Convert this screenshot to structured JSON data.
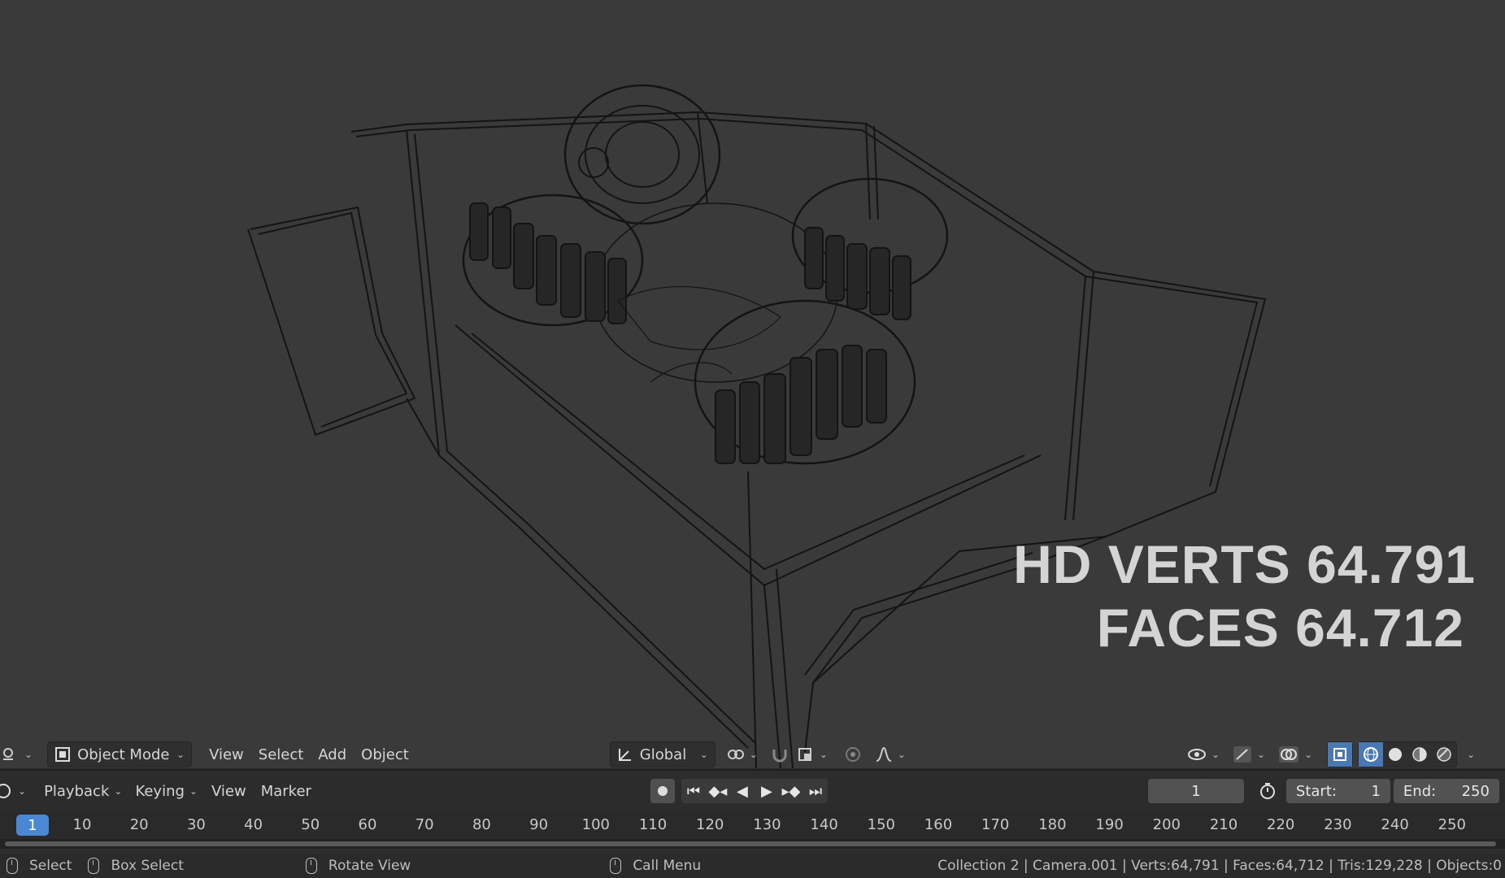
{
  "overlay": {
    "line1": "HD VERTS 64.791",
    "line2": "FACES 64.712"
  },
  "header3d": {
    "mode": "Object Mode",
    "menus": [
      "View",
      "Select",
      "Add",
      "Object"
    ],
    "orientation": "Global"
  },
  "timeline": {
    "menus": [
      "Playback",
      "Keying",
      "View",
      "Marker"
    ],
    "current_frame": "1",
    "start_label": "Start:",
    "start_value": "1",
    "end_label": "End:",
    "end_value": "250",
    "ruler_current": "1",
    "ruler_ticks": [
      "10",
      "20",
      "30",
      "40",
      "50",
      "60",
      "70",
      "80",
      "90",
      "100",
      "110",
      "120",
      "130",
      "140",
      "150",
      "160",
      "170",
      "180",
      "190",
      "200",
      "210",
      "220",
      "230",
      "240",
      "250"
    ]
  },
  "status": {
    "select": "Select",
    "box_select": "Box Select",
    "rotate_view": "Rotate View",
    "call_menu": "Call Menu",
    "stats": "Collection 2 | Camera.001 | Verts:64,791 | Faces:64,712 | Tris:129,228 | Objects:0"
  },
  "colors": {
    "accent": "#4a78b5",
    "frame_highlight": "#4a88d6",
    "viewport_bg": "#3a3a3a"
  }
}
